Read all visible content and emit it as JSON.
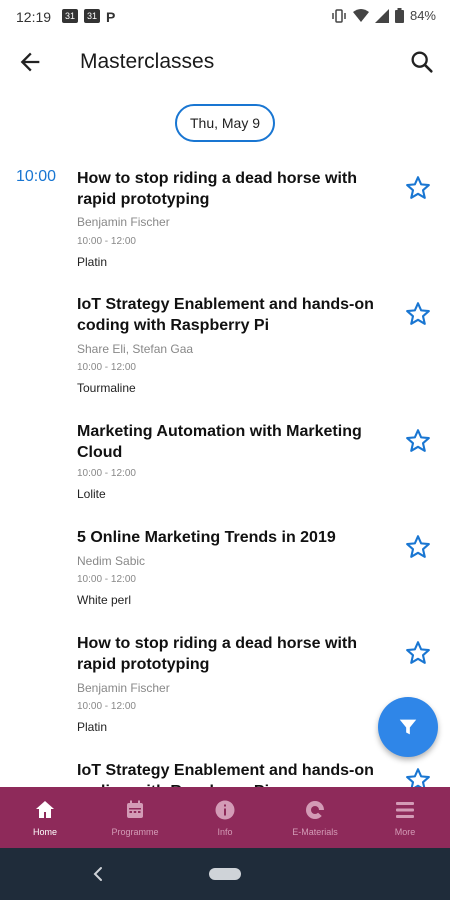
{
  "status_bar": {
    "time": "12:19",
    "battery": "84%"
  },
  "app_bar": {
    "title": "Masterclasses"
  },
  "date_chip": {
    "label": "Thu, May 9"
  },
  "sessions": [
    {
      "time": "10:00",
      "title": "How to stop riding a dead horse with rapid prototyping",
      "speaker": "Benjamin Fischer",
      "hours": "10:00 - 12:00",
      "room": "Platin"
    },
    {
      "time": "",
      "title": "IoT Strategy Enablement and hands-on coding with Raspberry Pi",
      "speaker": "Share Eli, Stefan  Gaa",
      "hours": "10:00 - 12:00",
      "room": "Tourmaline"
    },
    {
      "time": "",
      "title": "Marketing Automation with Marketing Cloud",
      "speaker": "",
      "hours": "10:00 - 12:00",
      "room": "Lolite"
    },
    {
      "time": "",
      "title": "5 Online Marketing Trends in 2019",
      "speaker": "Nedim Sabic",
      "hours": "10:00 - 12:00",
      "room": "White perl"
    },
    {
      "time": "",
      "title": "How to stop riding a dead horse with rapid prototyping",
      "speaker": "Benjamin Fischer",
      "hours": "10:00 - 12:00",
      "room": "Platin"
    },
    {
      "time": "",
      "title": "IoT Strategy Enablement and hands-on coding with Raspberry Pi",
      "speaker": "",
      "hours": "",
      "room": ""
    }
  ],
  "bottom_nav": {
    "items": [
      {
        "label": "Home",
        "icon": "home-icon"
      },
      {
        "label": "Programme",
        "icon": "calendar-icon"
      },
      {
        "label": "Info",
        "icon": "info-icon"
      },
      {
        "label": "E-Materials",
        "icon": "e-materials-icon"
      },
      {
        "label": "More",
        "icon": "menu-icon"
      }
    ]
  },
  "colors": {
    "accent": "#1976d2",
    "fab": "#2f86e8",
    "nav_bar": "#8e2a5a",
    "system_nav": "#1f2c3a"
  }
}
